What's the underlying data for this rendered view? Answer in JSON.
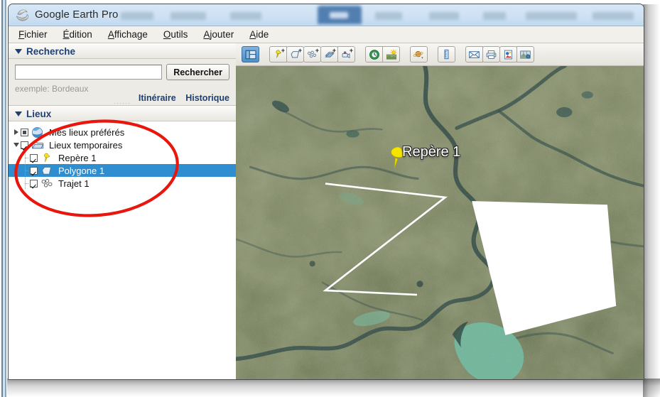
{
  "window": {
    "title": "Google Earth Pro",
    "app_icon": "earth-globe-icon"
  },
  "menubar": {
    "items": [
      {
        "label": "Fichier",
        "mnemonic": "F"
      },
      {
        "label": "Édition",
        "mnemonic": "É"
      },
      {
        "label": "Affichage",
        "mnemonic": "A"
      },
      {
        "label": "Outils",
        "mnemonic": "O"
      },
      {
        "label": "Ajouter",
        "mnemonic": "A"
      },
      {
        "label": "Aide",
        "mnemonic": "A"
      }
    ]
  },
  "sidebar": {
    "search_panel": {
      "title": "Recherche",
      "input_value": "",
      "input_placeholder": "",
      "button_label": "Rechercher",
      "hint": "exemple: Bordeaux",
      "links": [
        "Itinéraire",
        "Historique"
      ]
    },
    "places_panel": {
      "title": "Lieux",
      "items": [
        {
          "label": "Mes lieux préférés",
          "icon": "earth-globe-icon",
          "checkbox": "partial",
          "expander": "collapsed",
          "depth": 0,
          "selected": false
        },
        {
          "label": "Lieux temporaires",
          "icon": "folder-icon",
          "checkbox": "checked",
          "expander": "expanded",
          "depth": 0,
          "selected": false
        },
        {
          "label": "Repère 1",
          "icon": "pushpin-icon",
          "checkbox": "checked",
          "expander": "none",
          "depth": 1,
          "selected": false
        },
        {
          "label": "Polygone 1",
          "icon": "polygon-icon",
          "checkbox": "checked",
          "expander": "none",
          "depth": 1,
          "selected": true
        },
        {
          "label": "Trajet 1",
          "icon": "path-icon",
          "checkbox": "checked",
          "expander": "none",
          "depth": 1,
          "selected": false
        }
      ]
    }
  },
  "toolbar": {
    "groups": [
      {
        "buttons": [
          {
            "name": "toggle-sidebar-button",
            "icon": "sidebar-panel-icon",
            "active": true,
            "plus": false
          }
        ]
      },
      {
        "buttons": [
          {
            "name": "add-placemark-button",
            "icon": "pushpin-icon",
            "active": false,
            "plus": true
          },
          {
            "name": "add-polygon-button",
            "icon": "polygon-icon",
            "active": false,
            "plus": true
          },
          {
            "name": "add-path-button",
            "icon": "path-icon",
            "active": false,
            "plus": true
          },
          {
            "name": "add-image-overlay-button",
            "icon": "image-overlay-icon",
            "active": false,
            "plus": true
          },
          {
            "name": "record-tour-button",
            "icon": "movie-camera-icon",
            "active": false,
            "plus": true
          }
        ]
      },
      {
        "buttons": [
          {
            "name": "historical-imagery-button",
            "icon": "clock-icon",
            "active": false,
            "plus": false
          },
          {
            "name": "sunlight-button",
            "icon": "sun-icon",
            "active": false,
            "plus": false
          }
        ]
      },
      {
        "buttons": [
          {
            "name": "planet-switch-button",
            "icon": "planet-icon",
            "active": false,
            "plus": false
          }
        ]
      },
      {
        "buttons": [
          {
            "name": "ruler-button",
            "icon": "ruler-icon",
            "active": false,
            "plus": false
          }
        ]
      },
      {
        "buttons": [
          {
            "name": "email-button",
            "icon": "envelope-icon",
            "active": false,
            "plus": false
          },
          {
            "name": "print-button",
            "icon": "printer-icon",
            "active": false,
            "plus": false
          },
          {
            "name": "save-image-button",
            "icon": "save-image-icon",
            "active": false,
            "plus": false
          },
          {
            "name": "view-in-maps-button",
            "icon": "map-globe-icon",
            "active": false,
            "plus": false
          }
        ]
      }
    ]
  },
  "map": {
    "placemark_label": "Repère 1",
    "overlays": {
      "polygon_fill": "#ffffff",
      "path_stroke": "#ffffff"
    }
  },
  "annotation": {
    "ellipse_color": "#e8160c"
  }
}
